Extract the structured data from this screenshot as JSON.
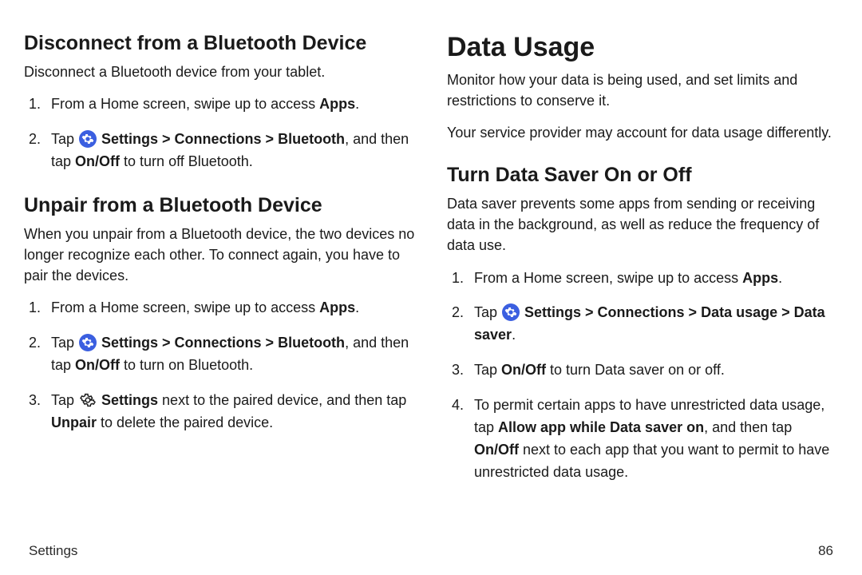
{
  "left": {
    "h1": "Disconnect from a Bluetooth Device",
    "p1": "Disconnect a Bluetooth device from your tablet.",
    "s1_pre": "From a Home screen, swipe up to access ",
    "s1_b": "Apps",
    "s1_post": ".",
    "s2_pre": "Tap ",
    "s2_path": " Settings > Connections > Bluetooth",
    "s2_mid": ", and then tap ",
    "s2_onoff": "On/Off",
    "s2_post": " to turn off Bluetooth.",
    "h2": "Unpair from a Bluetooth Device",
    "p2": "When you unpair from a Bluetooth device, the two devices no longer recognize each other. To connect again, you have to pair the devices.",
    "u1_pre": "From a Home screen, swipe up to access ",
    "u1_b": "Apps",
    "u1_post": ".",
    "u2_pre": "Tap ",
    "u2_path": " Settings > Connections > Bluetooth",
    "u2_mid": ", and then tap ",
    "u2_onoff": "On/Off",
    "u2_post": " to turn on Bluetooth.",
    "u3_pre": "Tap ",
    "u3_settings": " Settings",
    "u3_mid": " next to the paired device, and then tap ",
    "u3_unpair": "Unpair",
    "u3_post": " to delete the paired device."
  },
  "right": {
    "h1": "Data Usage",
    "p1": "Monitor how your data is being used, and set limits and restrictions to conserve it.",
    "p2": "Your service provider may account for data usage differently.",
    "h2": "Turn Data Saver On or Off",
    "p3": "Data saver prevents some apps from sending or receiving data in the background, as well as reduce the frequency of data use.",
    "d1_pre": "From a Home screen, swipe up to access ",
    "d1_b": "Apps",
    "d1_post": ".",
    "d2_pre": "Tap ",
    "d2_path": " Settings > Connections > Data usage > Data saver",
    "d2_post": ".",
    "d3_pre": "Tap ",
    "d3_onoff": "On/Off",
    "d3_post": " to turn Data saver on or off.",
    "d4_pre": "To permit certain apps to have unrestricted data usage, tap ",
    "d4_allow": "Allow app while Data saver on",
    "d4_mid": ", and then tap ",
    "d4_onoff": "On/Off",
    "d4_post": " next to each app that you want to permit to have unrestricted data usage."
  },
  "footer": {
    "section": "Settings",
    "page": "86"
  }
}
